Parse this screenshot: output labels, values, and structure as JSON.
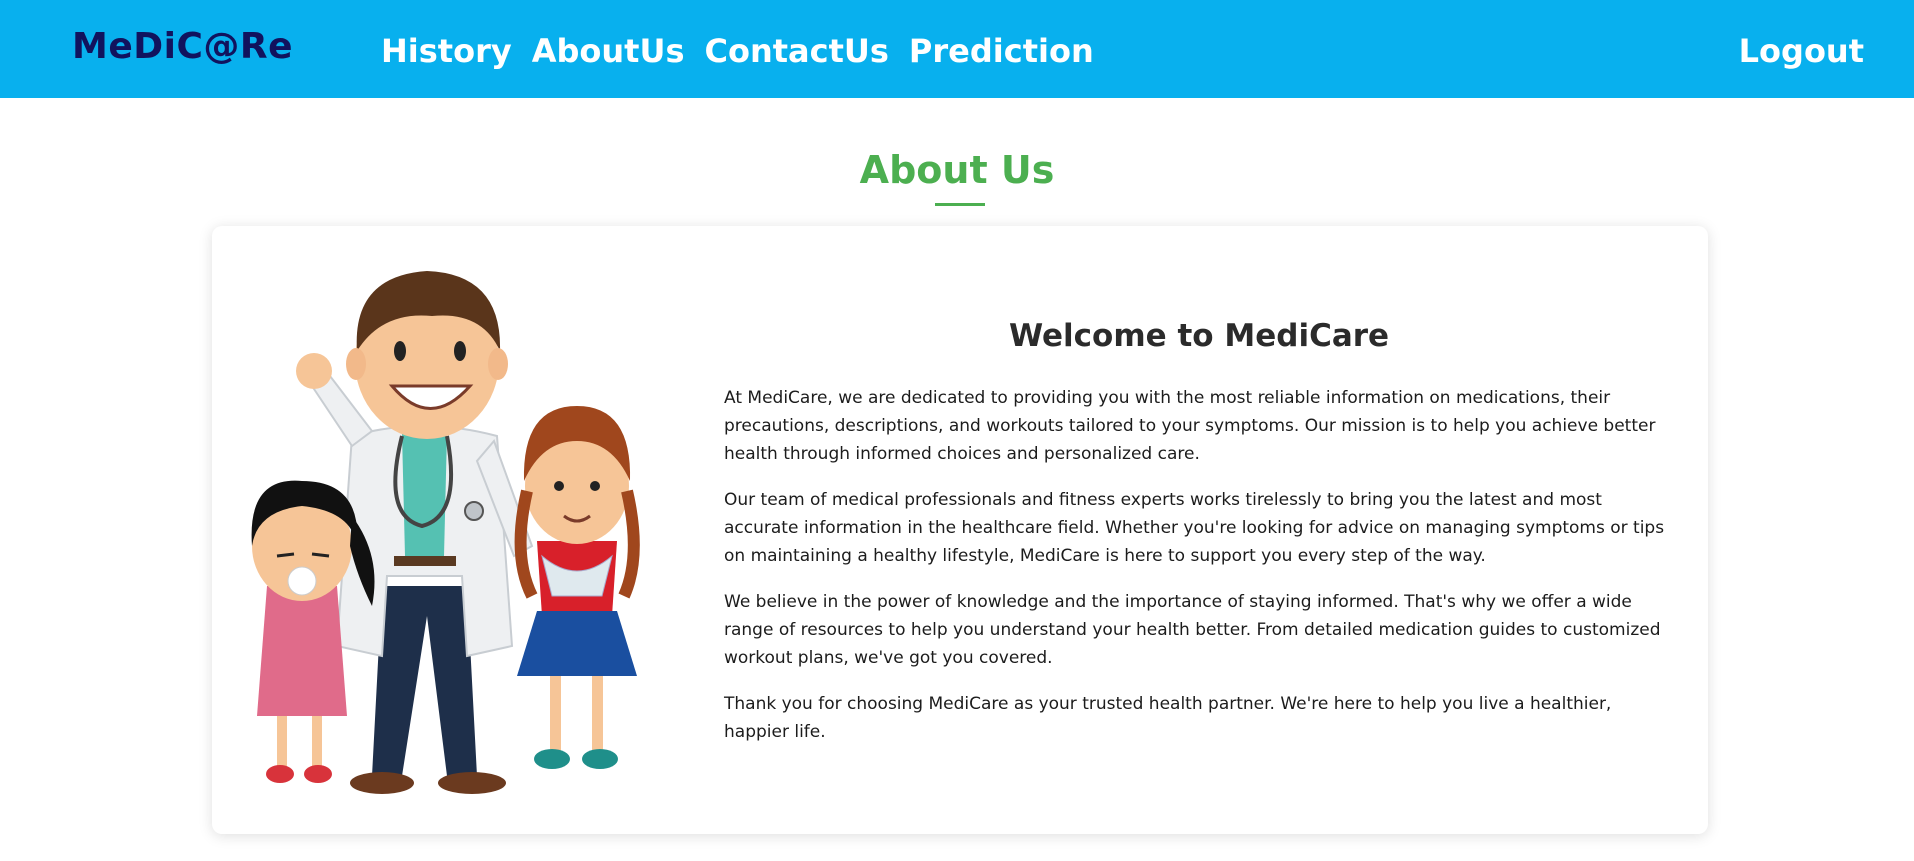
{
  "header": {
    "brand": "MeDiC@Re",
    "nav": [
      {
        "label": "History"
      },
      {
        "label": "AboutUs"
      },
      {
        "label": "ContactUs"
      },
      {
        "label": "Prediction"
      }
    ],
    "logout_label": "Logout"
  },
  "section": {
    "title": "About Us"
  },
  "card": {
    "illustration_icon": "doctor-with-children-illustration",
    "heading": "Welcome to MediCare",
    "paragraphs": [
      "At MediCare, we are dedicated to providing you with the most reliable information on medications, their precautions, descriptions, and workouts tailored to your symptoms. Our mission is to help you achieve better health through informed choices and personalized care.",
      "Our team of medical professionals and fitness experts works tirelessly to bring you the latest and most accurate information in the healthcare field. Whether you're looking for advice on managing symptoms or tips on maintaining a healthy lifestyle, MediCare is here to support you every step of the way.",
      "We believe in the power of knowledge and the importance of staying informed. That's why we offer a wide range of resources to help you understand your health better. From detailed medication guides to customized workout plans, we've got you covered.",
      "Thank you for choosing MediCare as your trusted health partner. We're here to help you live a healthier, happier life."
    ]
  },
  "colors": {
    "navbar": "#08b0ee",
    "brand": "#11135e",
    "accent_green": "#4caf50"
  }
}
